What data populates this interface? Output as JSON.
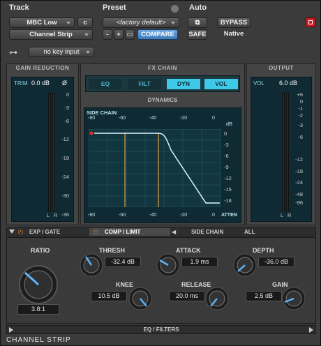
{
  "header": {
    "track_label": "Track",
    "preset_label": "Preset",
    "auto_label": "Auto",
    "track_name": "MBC Low",
    "track_channel": "c",
    "insert_name": "Channel Strip",
    "preset_name": "<factory default>",
    "compare_label": "COMPARE",
    "safe_label": "SAFE",
    "bypass_label": "BYPASS",
    "native_label": "Native",
    "key_input": "no key input",
    "minus": "-",
    "plus": "+"
  },
  "gain_reduction": {
    "title": "GAIN REDUCTION",
    "trim_label": "TRIM",
    "trim_value": "0.0 dB",
    "phase": "Ø",
    "scale": [
      "0",
      "-3",
      "-6",
      "-12",
      "-18",
      "-24",
      "-30",
      "-36"
    ],
    "left": "L",
    "right": "R"
  },
  "fx_chain": {
    "title": "FX CHAIN",
    "items": [
      "EQ",
      "FILT",
      "DYN",
      "VOL"
    ]
  },
  "dynamics": {
    "title": "DYNAMICS",
    "side_chain": "SIDE CHAIN",
    "db": "dB",
    "atten": "ATTEN",
    "top_ticks": [
      "-80",
      "-60",
      "-40",
      "-20",
      "0"
    ],
    "bottom_ticks": [
      "-80",
      "-60",
      "-40",
      "-20",
      "0"
    ],
    "right_ticks": [
      "0",
      "-3",
      "-6",
      "-9",
      "-12",
      "-15",
      "-18"
    ]
  },
  "output": {
    "title": "OUTPUT",
    "vol_label": "VOL",
    "vol_value": "6.0 dB",
    "scale": [
      "+6",
      "0",
      "-1",
      "-2",
      "-3",
      "-6",
      "-12",
      "-18",
      "-24",
      "-48",
      "-96"
    ],
    "left": "L",
    "right": "R"
  },
  "tabs": [
    "EXP / GATE",
    "COMP / LIMIT",
    "SIDE CHAIN",
    "ALL"
  ],
  "controls": {
    "ratio": {
      "label": "RATIO",
      "value": "3.8:1"
    },
    "thresh": {
      "label": "THRESH",
      "value": "-32.4 dB"
    },
    "knee": {
      "label": "KNEE",
      "value": "10.5 dB"
    },
    "attack": {
      "label": "ATTACK",
      "value": "1.9 ms"
    },
    "release": {
      "label": "RELEASE",
      "value": "20.0 ms"
    },
    "depth": {
      "label": "DEPTH",
      "value": "-36.0 dB"
    },
    "gain": {
      "label": "GAIN",
      "value": "2.5 dB"
    }
  },
  "eq_filters": "EQ / FILTERS",
  "footer": "CHANNEL STRIP",
  "colors": {
    "accent": "#3ec9e8",
    "lcd": "#0f2a33",
    "curve": "#dff4ff",
    "marker": "#e0a040"
  }
}
